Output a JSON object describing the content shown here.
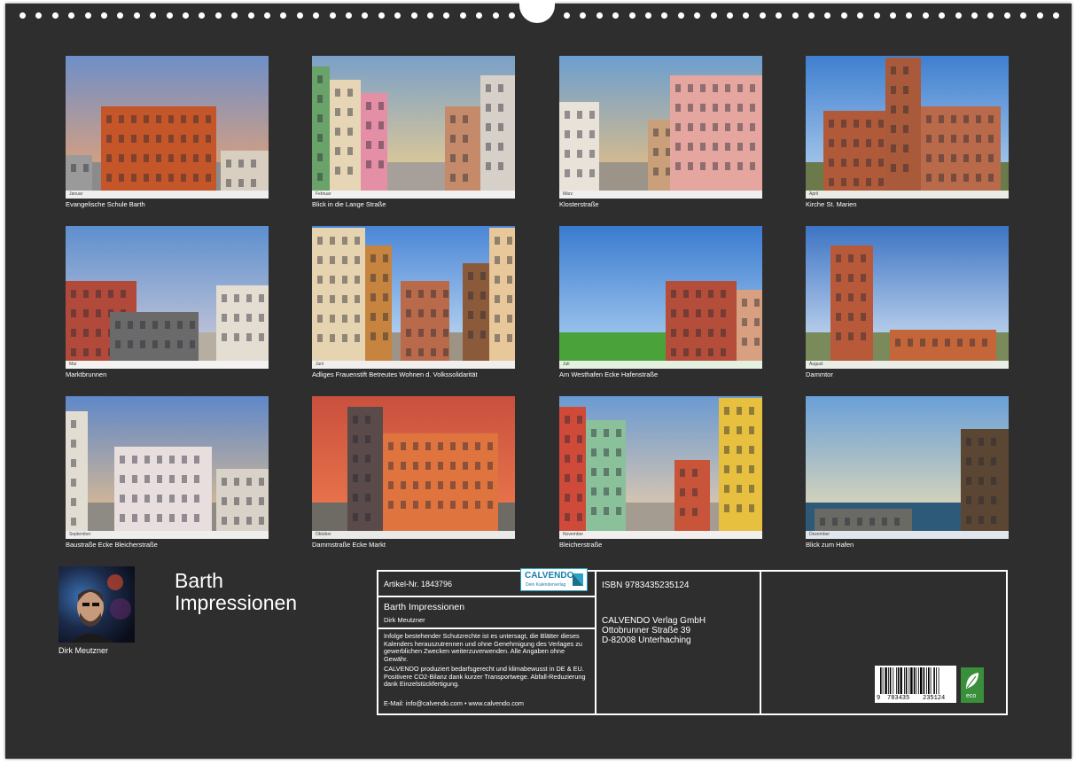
{
  "photos": [
    {
      "caption": "Evangelische Schule Barth",
      "month": "Januar"
    },
    {
      "caption": "Blick in die Lange Straße",
      "month": "Februar"
    },
    {
      "caption": "Klosterstraße",
      "month": "März"
    },
    {
      "caption": "Kirche St. Marien",
      "month": "April"
    },
    {
      "caption": "Marktbrunnen",
      "month": "Mai"
    },
    {
      "caption": "Adliges Frauenstift Betreutes Wohnen d. Volkssolidarität",
      "month": "Juni"
    },
    {
      "caption": "Am Westhafen Ecke Hafenstraße",
      "month": "Juli"
    },
    {
      "caption": "Dammtor",
      "month": "August"
    },
    {
      "caption": "Baustraße Ecke Bleicherstraße",
      "month": "September"
    },
    {
      "caption": "Dammstraße Ecke Markt",
      "month": "Oktober"
    },
    {
      "caption": "Bleicherstraße",
      "month": "November"
    },
    {
      "caption": "Blick zum Hafen",
      "month": "Dezember"
    }
  ],
  "calendar": {
    "title_line1": "Barth",
    "title_line2": "Impressionen",
    "author": "Dirk Meutzner"
  },
  "info": {
    "article": "Artikel-Nr. 1843796",
    "logo_brand": "CALVENDO",
    "logo_tagline": "Dein Kalenderverlag",
    "product_title": "Barth Impressionen",
    "product_author": "Dirk Meutzner",
    "legal_text": "Infolge bestehender Schutzrechte ist es untersagt, die Blätter dieses Kalenders herauszutrennen und ohne Genehmigung des Verlages zu gewerblichen Zwecken weiterzuverwenden. Alle Angaben ohne Gewähr.",
    "eco_text": "CALVENDO produziert bedarfsgerecht und klimabewusst in DE & EU. Positivere CO2-Bilanz dank kurzer Transportwege. Abfall-Reduzierung dank Einzelstückfertigung.",
    "contact": "E-Mail: info@calvendo.com • www.calvendo.com",
    "isbn": "ISBN 9783435235124",
    "publisher": "CALVENDO Verlag GmbH",
    "street": "Ottobrunner Straße 39",
    "city": "D-82008 Unterhaching",
    "barcode_first": "9",
    "barcode_left": "783435",
    "barcode_right": "235124",
    "eco_badge": "eco"
  },
  "colors": {
    "background": "#2e2e2e",
    "accent": "#2aa3c9",
    "eco_green": "#3a8f3a"
  }
}
